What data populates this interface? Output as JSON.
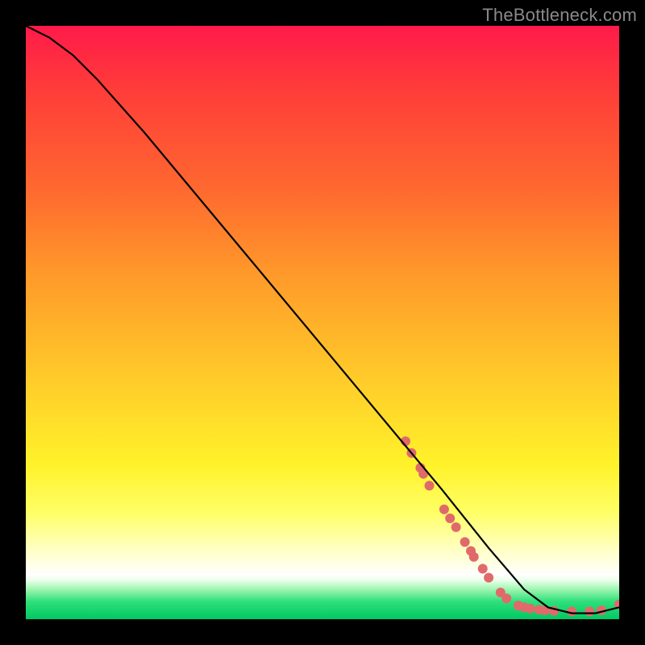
{
  "watermark": "TheBottleneck.com",
  "chart_data": {
    "type": "line",
    "title": "",
    "xlabel": "",
    "ylabel": "",
    "xlim": [
      0,
      100
    ],
    "ylim": [
      0,
      100
    ],
    "grid": false,
    "legend": false,
    "series": [
      {
        "name": "curve",
        "color": "#000000",
        "x": [
          0,
          4,
          8,
          12,
          20,
          30,
          40,
          50,
          60,
          70,
          78,
          84,
          88,
          92,
          96,
          100
        ],
        "y": [
          100,
          98,
          95,
          91,
          82,
          70,
          58,
          46,
          34,
          22,
          12,
          5,
          2,
          1,
          1,
          2
        ]
      }
    ],
    "markers": [
      {
        "name": "highlight-points",
        "color": "#e06a6a",
        "radius": 6,
        "points": [
          {
            "x": 64,
            "y": 30
          },
          {
            "x": 65,
            "y": 28
          },
          {
            "x": 66.5,
            "y": 25.5
          },
          {
            "x": 67,
            "y": 24.5
          },
          {
            "x": 68,
            "y": 22.5
          },
          {
            "x": 70.5,
            "y": 18.5
          },
          {
            "x": 71.5,
            "y": 17
          },
          {
            "x": 72.5,
            "y": 15.5
          },
          {
            "x": 74,
            "y": 13
          },
          {
            "x": 75,
            "y": 11.5
          },
          {
            "x": 75.5,
            "y": 10.5
          },
          {
            "x": 77,
            "y": 8.5
          },
          {
            "x": 78,
            "y": 7
          },
          {
            "x": 80,
            "y": 4.5
          },
          {
            "x": 81,
            "y": 3.5
          },
          {
            "x": 83,
            "y": 2.3
          },
          {
            "x": 84,
            "y": 2
          },
          {
            "x": 85,
            "y": 1.8
          },
          {
            "x": 86.5,
            "y": 1.6
          },
          {
            "x": 87.5,
            "y": 1.5
          },
          {
            "x": 89,
            "y": 1.4
          },
          {
            "x": 92,
            "y": 1.3
          },
          {
            "x": 95,
            "y": 1.3
          },
          {
            "x": 97,
            "y": 1.5
          },
          {
            "x": 100,
            "y": 2.5
          }
        ]
      }
    ]
  }
}
